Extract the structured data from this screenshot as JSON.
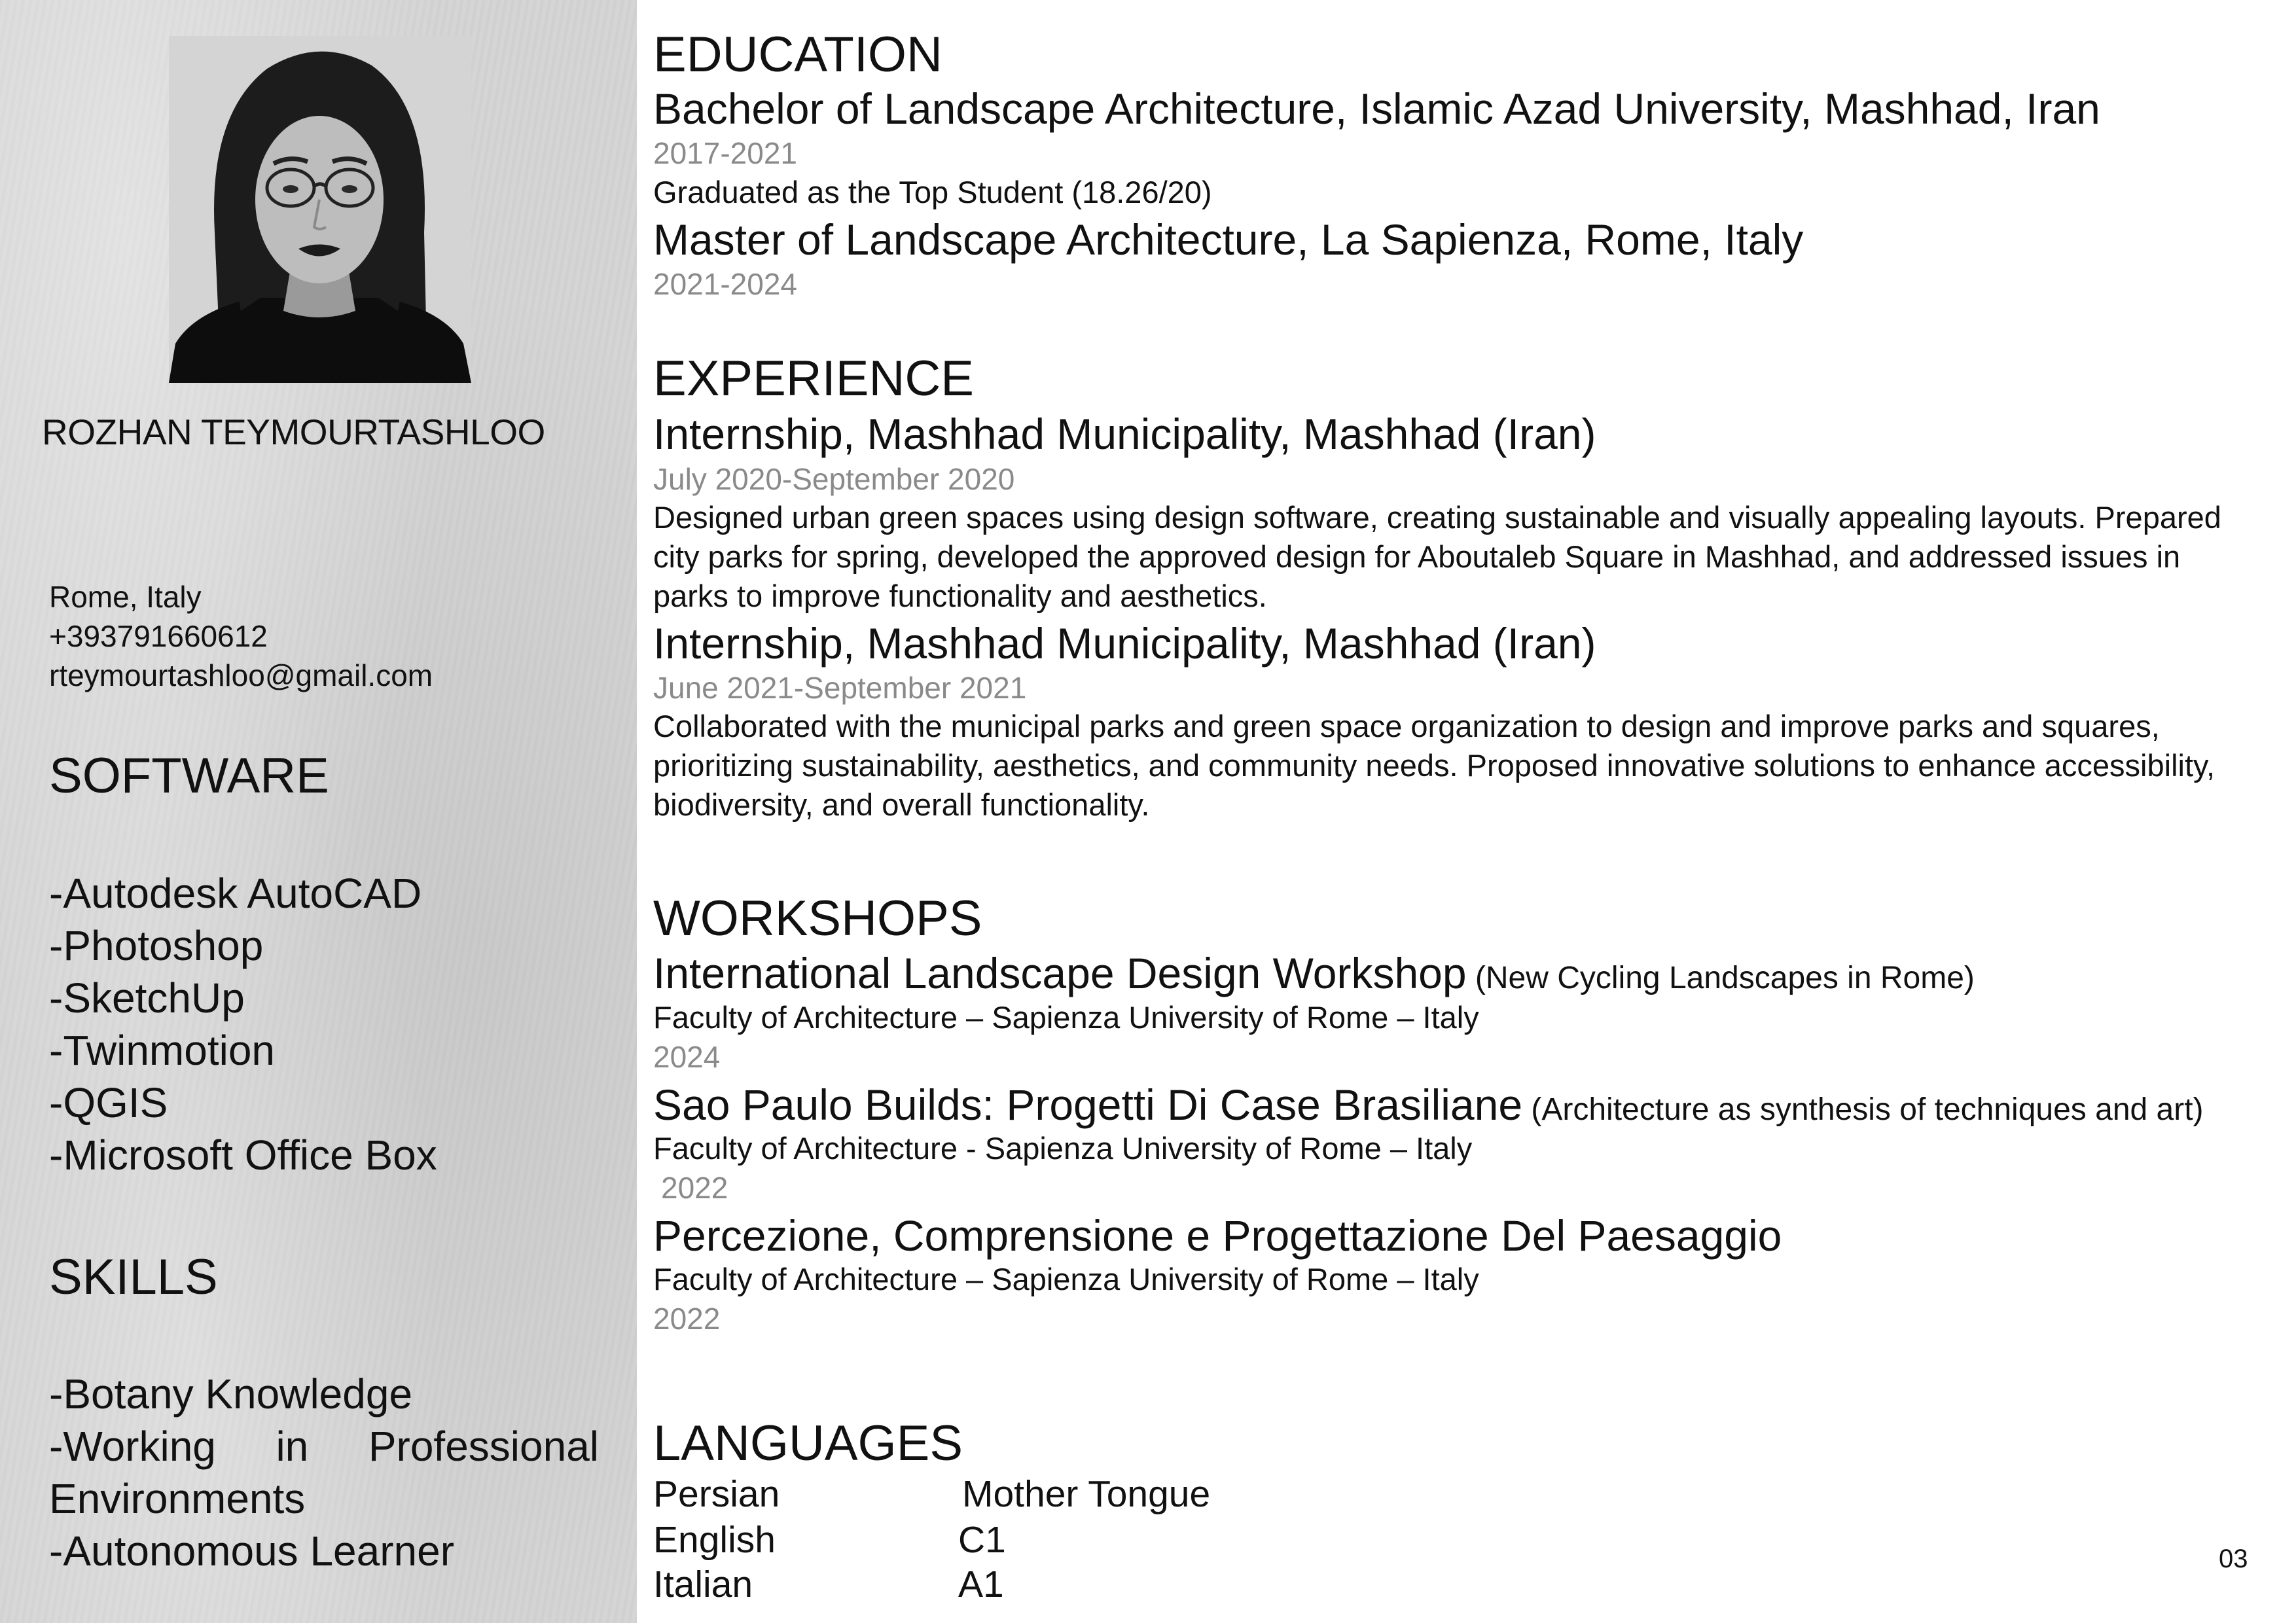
{
  "profile": {
    "name": "ROZHAN TEYMOURTASHLOO",
    "location": "Rome, Italy",
    "phone": "+393791660612",
    "email": "rteymourtashloo@gmail.com"
  },
  "software": {
    "heading": "SOFTWARE",
    "items": [
      "-Autodesk AutoCAD",
      "-Photoshop",
      "-SketchUp",
      "-Twinmotion",
      "-QGIS",
      "-Microsoft Office Box"
    ]
  },
  "skills": {
    "heading": "SKILLS",
    "item1": "-Botany Knowledge",
    "item2_words": [
      "-Working",
      "in",
      "Professional"
    ],
    "item2_cont": "Environments",
    "item3": "-Autonomous Learner"
  },
  "education": {
    "heading": "EDUCATION",
    "entries": [
      {
        "title": "Bachelor of Landscape Architecture, Islamic Azad University, Mashhad, Iran",
        "date": "2017-2021",
        "note": "Graduated as the Top Student (18.26/20)"
      },
      {
        "title": "Master of Landscape Architecture, La Sapienza, Rome, Italy",
        "date": "2021-2024"
      }
    ]
  },
  "experience": {
    "heading": "EXPERIENCE",
    "entries": [
      {
        "title": "Internship, Mashhad Municipality, Mashhad (Iran)",
        "date": "July 2020-September 2020",
        "lines": [
          "Designed urban green spaces using design software, creating sustainable and visually appealing layouts. Prepared",
          "city parks for spring, developed the approved design for Aboutaleb Square in Mashhad, and addressed issues in",
          "parks to improve functionality and aesthetics."
        ]
      },
      {
        "title": "Internship, Mashhad Municipality, Mashhad (Iran)",
        "date": "June 2021-September 2021",
        "lines": [
          "Collaborated with the municipal parks and green space organization to design and improve parks and squares,",
          "prioritizing sustainability, aesthetics, and community needs. Proposed innovative solutions to enhance accessibility,",
          "biodiversity, and overall functionality."
        ]
      }
    ]
  },
  "workshops": {
    "heading": "WORKSHOPS",
    "entries": [
      {
        "title": "International Landscape Design Workshop",
        "note": " (New Cycling Landscapes in Rome)",
        "institution": "Faculty of Architecture – Sapienza University of Rome – Italy",
        "date": "2024"
      },
      {
        "title": "Sao Paulo Builds: Progetti Di Case Brasiliane",
        "note": " (Architecture as synthesis of techniques and art)",
        "institution": "Faculty of Architecture - Sapienza University of Rome – Italy",
        "date": "2022"
      },
      {
        "title": "Percezione, Comprensione e Progettazione Del Paesaggio",
        "note": "",
        "institution": "Faculty of Architecture – Sapienza University of Rome – Italy",
        "date": "2022"
      }
    ]
  },
  "languages": {
    "heading": "LANGUAGES",
    "rows": [
      {
        "language": "Persian",
        "level": "Mother Tongue"
      },
      {
        "language": "English",
        "level": "C1"
      },
      {
        "language": "Italian",
        "level": "A1"
      }
    ]
  },
  "page_number": "03"
}
